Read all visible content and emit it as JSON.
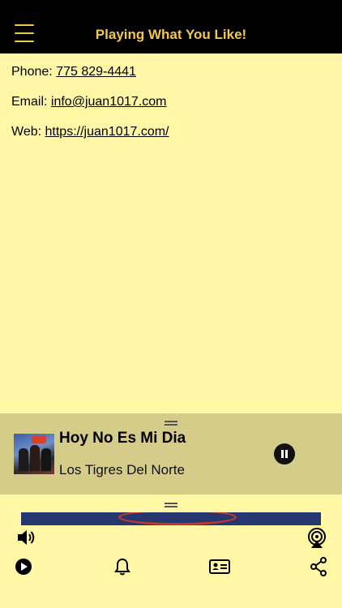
{
  "header": {
    "title": "Playing What You Like!"
  },
  "contact": {
    "phone_label": "Phone:",
    "phone_value": "775 829-4441",
    "email_label": "Email:",
    "email_value": "info@juan1017.com",
    "web_label": "Web:",
    "web_value": "https://juan1017.com/"
  },
  "player": {
    "song_title": "Hoy No Es Mi Dia",
    "artist": "Los Tigres Del Norte",
    "state": "playing"
  },
  "colors": {
    "accent": "#f2c94c",
    "background": "#fff6a6",
    "player_bg": "#d5cc89",
    "header_bg": "#000000"
  },
  "icons": [
    "menu-icon",
    "volume-icon",
    "airplay-icon",
    "play-icon",
    "bell-icon",
    "contact-card-icon",
    "share-icon",
    "pause-icon"
  ]
}
